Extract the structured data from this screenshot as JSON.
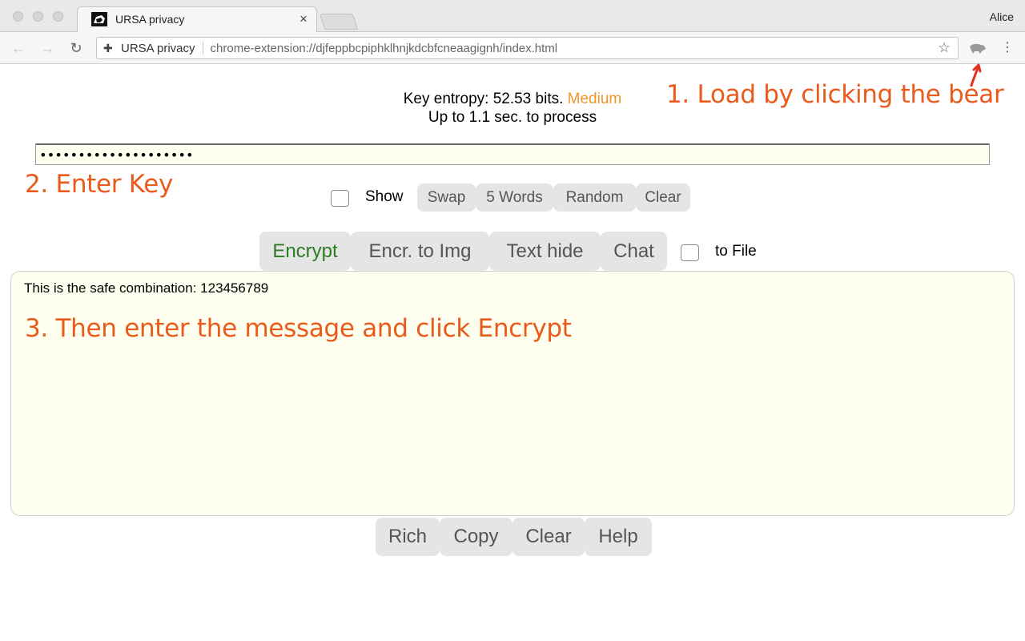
{
  "browser": {
    "tab_title": "URSA privacy",
    "tab_close": "×",
    "profile_name": "Alice",
    "omnibox_site": "URSA privacy",
    "omnibox_url": "chrome-extension://djfeppbcpiphklhnjkdcbfcneaagignh/index.html",
    "back": "←",
    "forward": "→",
    "reload": "↻",
    "star": "☆",
    "menu": "⋮",
    "puzzle": "✚"
  },
  "key_info": {
    "entropy_text": "Key entropy: 52.53 bits.",
    "entropy_level": "Medium",
    "process_text": "Up to 1.1 sec. to process"
  },
  "annotations": {
    "step1": "1. Load by clicking the bear",
    "step2": "2. Enter Key",
    "step3": "3. Then enter the message and click Encrypt"
  },
  "key_field": {
    "value": "••••••••••••••••••••"
  },
  "key_controls": {
    "show_label": "Show",
    "show_checked": false,
    "buttons": [
      "Swap",
      "5 Words",
      "Random",
      "Clear"
    ]
  },
  "main_buttons": {
    "encrypt": "Encrypt",
    "encr_to_img": "Encr. to Img",
    "text_hide": "Text hide",
    "chat": "Chat",
    "to_file_label": "to File",
    "to_file_checked": false
  },
  "message": {
    "text": "This is the safe combination: 123456789"
  },
  "bottom_buttons": [
    "Rich",
    "Copy",
    "Clear",
    "Help"
  ],
  "colors": {
    "accent_orange": "#ea5a1b",
    "medium_level": "#f0952b",
    "encrypt_green": "#2b7c25",
    "field_bg": "#fffff0"
  }
}
